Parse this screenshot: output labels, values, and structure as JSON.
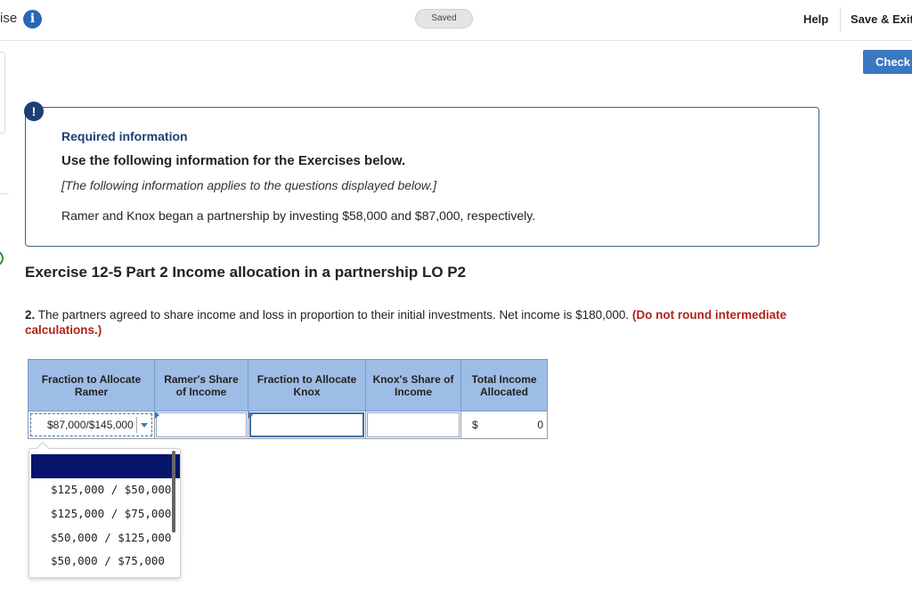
{
  "topbar": {
    "title_fragment": "ise",
    "saved_label": "Saved",
    "help_label": "Help",
    "save_exit_label": "Save & Exit",
    "check_label": "Check"
  },
  "info": {
    "required_title": "Required information",
    "heading": "Use the following information for the Exercises below.",
    "note": "[The following information applies to the questions displayed below.]",
    "body": "Ramer and Knox began a partnership by investing $58,000 and $87,000, respectively."
  },
  "exercise": {
    "title": "Exercise 12-5 Part 2 Income allocation in a partnership LO P2",
    "question_number": "2.",
    "question_text": " The partners agreed to share income and loss in proportion to their initial investments. Net income is $180,000. ",
    "question_note": "(Do not round intermediate calculations.)"
  },
  "table": {
    "headers": [
      "Fraction to Allocate Ramer",
      "Ramer's Share of Income",
      "Fraction to Allocate Knox",
      "Knox's Share of Income",
      "Total Income Allocated"
    ],
    "fraction_ramer_value": "$87,000/$145,000",
    "total_currency": "$",
    "total_value": "0"
  },
  "dropdown": {
    "options": [
      "$125,000 / $50,000",
      "$125,000 / $75,000",
      "$50,000 / $125,000",
      "$50,000 / $75,000"
    ]
  },
  "colors": {
    "accent": "#3a78c2",
    "header_bg": "#9ebde6",
    "warning_red": "#b0231b",
    "selected_option": "#06146b"
  }
}
